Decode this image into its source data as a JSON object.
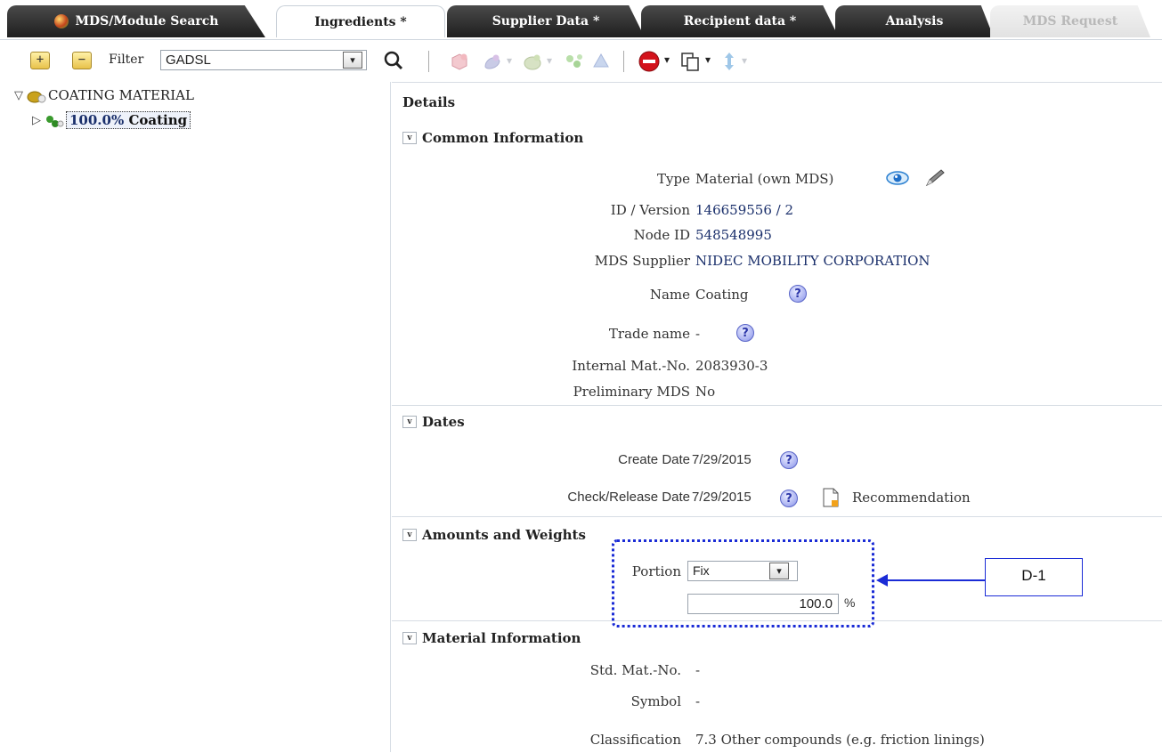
{
  "tabs": [
    {
      "label": "MDS/Module Search"
    },
    {
      "label": "Ingredients *"
    },
    {
      "label": "Supplier Data *"
    },
    {
      "label": "Recipient data *"
    },
    {
      "label": "Analysis"
    },
    {
      "label": "MDS Request"
    }
  ],
  "toolbar": {
    "expand_symbol": "+",
    "collapse_symbol": "−",
    "filter_label": "Filter",
    "filter_value": "GADSL",
    "dropdown_glyph": "▾"
  },
  "tree": {
    "root": {
      "toggle": "▽",
      "label": "COATING MATERIAL"
    },
    "child": {
      "toggle": "▷",
      "portion": "100.0%",
      "label": "Coating"
    }
  },
  "details": {
    "title": "Details",
    "common": {
      "title": "Common Information",
      "type_label": "Type",
      "type_value": "Material (own MDS)",
      "id_label": "ID / Version",
      "id_value": "146659556 / 2",
      "node_label": "Node ID",
      "node_value": "548548995",
      "supplier_label": "MDS Supplier",
      "supplier_value": "NIDEC MOBILITY CORPORATION",
      "name_label": "Name",
      "name_value": "Coating",
      "trade_label": "Trade name",
      "trade_value": "-",
      "internal_label": "Internal Mat.-No.",
      "internal_value": "2083930-3",
      "prelim_label": "Preliminary MDS",
      "prelim_value": "No"
    },
    "dates": {
      "title": "Dates",
      "create_label": "Create Date",
      "create_value": "7/29/2015",
      "check_label": "Check/Release Date",
      "check_value": "7/29/2015",
      "recommendation": "Recommendation"
    },
    "amounts": {
      "title": "Amounts and Weights",
      "portion_label": "Portion",
      "portion_value": "Fix",
      "percent_value": "100.0",
      "percent_unit": "%"
    },
    "material": {
      "title": "Material Information",
      "std_label": "Std. Mat.-No.",
      "std_value": "-",
      "symbol_label": "Symbol",
      "symbol_value": "-",
      "class_label": "Classification",
      "class_value": "7.3 Other compounds (e.g. friction linings)"
    }
  },
  "annotation": {
    "label": "D-1"
  },
  "help_glyph": "?",
  "colors": {
    "annotation_blue": "#1a2bd6",
    "tab_dark": "#2a2a2a",
    "value_blue": "#1a2f6b"
  }
}
